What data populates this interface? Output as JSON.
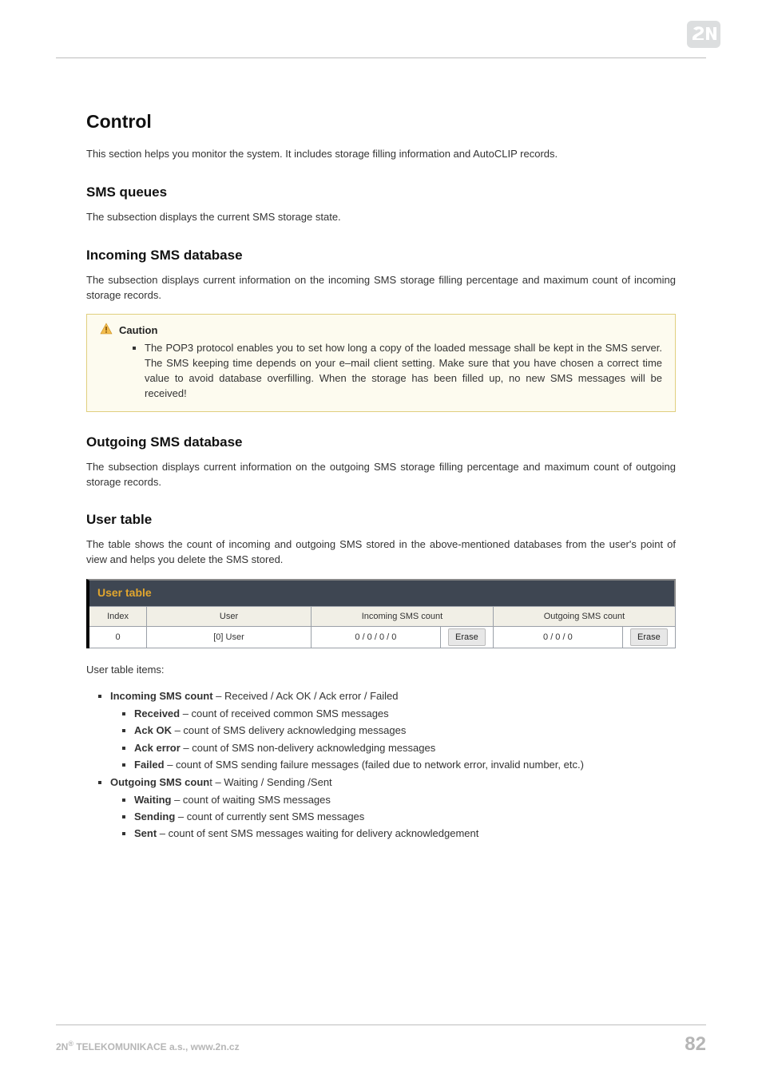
{
  "logo_name": "2N",
  "headings": {
    "control": "Control",
    "sms_queues": "SMS queues",
    "incoming_db": "Incoming SMS database",
    "outgoing_db": "Outgoing SMS database",
    "user_table": "User table"
  },
  "paragraphs": {
    "control_intro": "This section helps you monitor the system. It includes storage filling information and AutoCLIP records.",
    "sms_queues": "The subsection displays the current SMS storage state.",
    "incoming_db": "The subsection displays current information on the incoming SMS storage filling percentage and maximum count of incoming storage records.",
    "outgoing_db": "The subsection displays current information on the outgoing SMS storage filling percentage and maximum count of outgoing storage records.",
    "user_table": "The table shows the count of incoming and outgoing SMS stored in the above-mentioned databases from the user's point of view and helps you delete the SMS stored.",
    "user_table_items": "User table items:"
  },
  "caution": {
    "title": "Caution",
    "text": "The POP3 protocol enables you to set how long a copy of the loaded message shall be kept in the SMS server. The SMS keeping time depends on your e–mail client setting. Make sure that you have chosen a correct time value to avoid database overfilling. When the storage has been filled up, no new SMS messages will be received!"
  },
  "table": {
    "title": "User table",
    "headers": {
      "index": "Index",
      "user": "User",
      "incoming": "Incoming SMS count",
      "outgoing": "Outgoing SMS count"
    },
    "row": {
      "index": "0",
      "user": "[0] User",
      "incoming": "0 / 0 / 0 / 0",
      "outgoing": "0 / 0 / 0",
      "erase": "Erase"
    }
  },
  "items": {
    "incoming_label": "Incoming SMS count",
    "incoming_desc": " – Received / Ack OK / Ack error / Failed",
    "received_label": "Received",
    "received_desc": " – count of received common SMS messages",
    "ackok_label": "Ack OK",
    "ackok_desc": " – count of SMS delivery acknowledging messages",
    "ackerr_label": "Ack error",
    "ackerr_desc": " – count of SMS non-delivery acknowledging messages",
    "failed_label": "Failed",
    "failed_desc": " – count of SMS sending failure messages (failed due to network error, invalid number, etc.)",
    "outgoing_label": "Outgoing SMS coun",
    "outgoing_t": "t – Waiting / Sending /Sent",
    "waiting_label": "Waiting",
    "waiting_desc": " – count of waiting SMS messages",
    "sending_label": "Sending",
    "sending_desc": " – count of currently sent SMS messages",
    "sent_label": "Sent",
    "sent_desc": " – count of sent SMS messages waiting for delivery acknowledgement"
  },
  "footer": {
    "company_prefix": "2N",
    "company_sup": "®",
    "company_rest": " TELEKOMUNIKACE a.s., www.2n.cz",
    "page": "82"
  }
}
